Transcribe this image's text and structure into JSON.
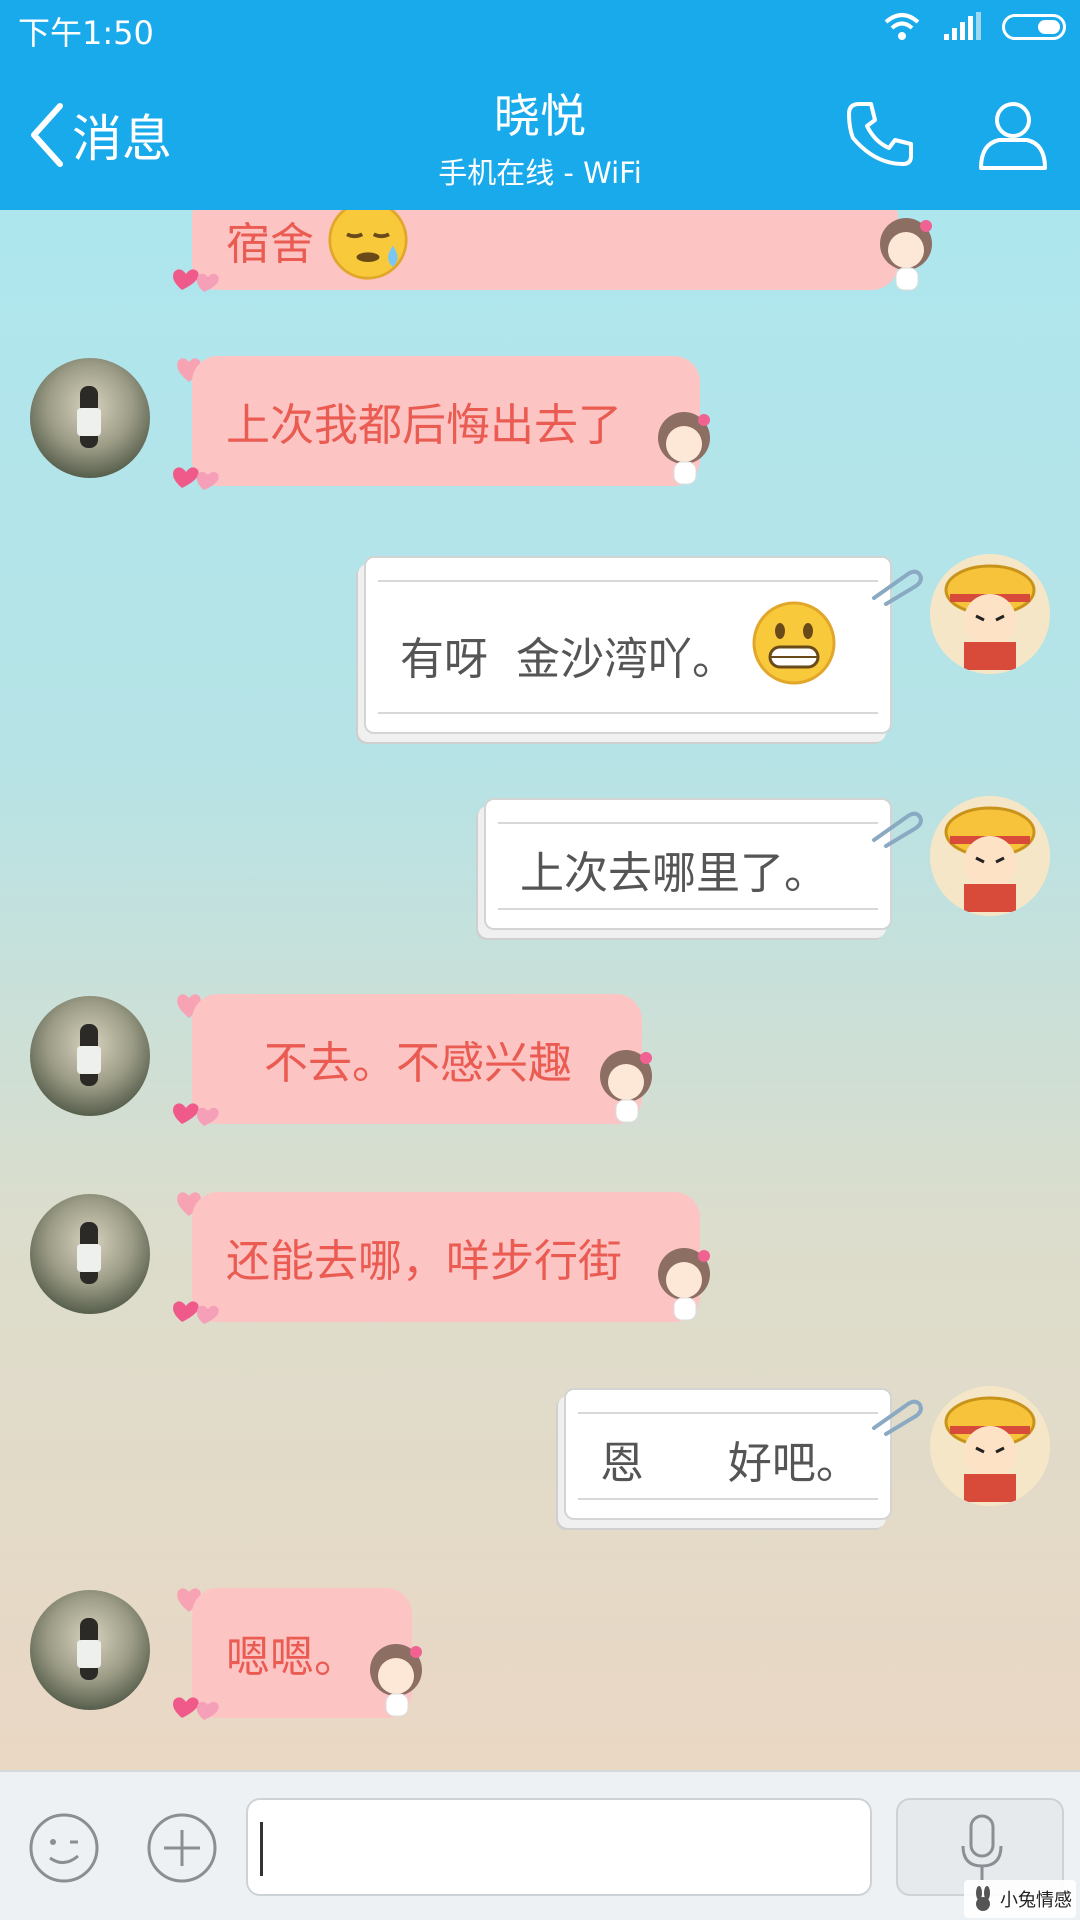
{
  "status": {
    "time": "下午1:50"
  },
  "header": {
    "back_label": "消息",
    "title": "晓悦",
    "subtitle": "手机在线 - WiFi",
    "brand_color": "#19aaeb"
  },
  "messages": [
    {
      "side": "in",
      "text": "宿舍",
      "emoji": "sleepy-face-icon"
    },
    {
      "side": "in",
      "text": "上次我都后悔出去了"
    },
    {
      "side": "out",
      "text": "有呀  金沙湾吖。",
      "emoji": "grinning-face-icon"
    },
    {
      "side": "out",
      "text": "上次去哪里了。"
    },
    {
      "side": "in",
      "text": "不去。不感兴趣"
    },
    {
      "side": "in",
      "text": "还能去哪，咩步行街"
    },
    {
      "side": "out",
      "text": "恩      好吧。"
    },
    {
      "side": "in",
      "text": "嗯嗯。"
    }
  ],
  "input": {
    "placeholder": ""
  },
  "watermark": {
    "text": "小兔情感"
  },
  "colors": {
    "incoming_bubble": "#fdc4c4",
    "incoming_text": "#ea5b52",
    "outgoing_text": "#555555"
  }
}
